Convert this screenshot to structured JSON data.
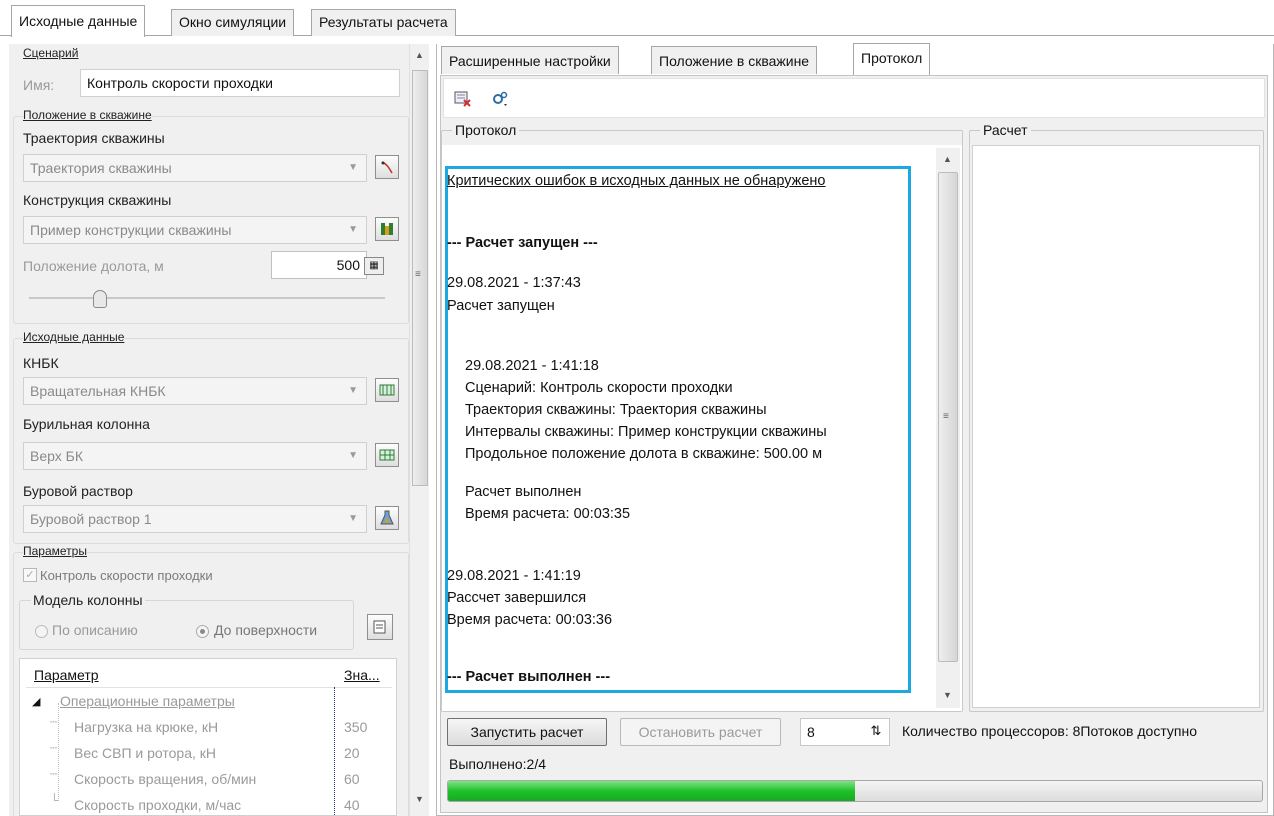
{
  "top_tabs": [
    "Исходные данные",
    "Окно симуляции",
    "Результаты расчета"
  ],
  "scenario": {
    "group": "Сценарий",
    "name_label": "Имя:",
    "name_value": "Контроль скорости проходки"
  },
  "position": {
    "group": "Положение в скважине",
    "trajectory_label": "Траектория скважины",
    "trajectory_value": "Траектория скважины",
    "construction_label": "Конструкция скважины",
    "construction_value": "Пример конструкции скважины",
    "bit_label": "Положение долота, м",
    "bit_value": "500"
  },
  "source": {
    "group": "Исходные данные",
    "knbk_label": "КНБК",
    "knbk_value": "Вращательная КНБК",
    "string_label": "Бурильная колонна",
    "string_value": "Верх БК",
    "mud_label": "Буровой раствор",
    "mud_value": "Буровой раствор 1"
  },
  "params": {
    "group": "Параметры",
    "rop_check": "Контроль скорости проходки",
    "model_title": "Модель колонны",
    "radio_desc": "По описанию",
    "radio_surface": "До поверхности",
    "col_param": "Параметр",
    "col_value": "Зна...",
    "category": "Операционные параметры",
    "rows": [
      {
        "name": "Нагрузка на крюке, кН",
        "value": "350"
      },
      {
        "name": "Вес СВП и ротора, кН",
        "value": "20"
      },
      {
        "name": "Скорость вращения, об/мин",
        "value": "60"
      },
      {
        "name": "Скорость проходки, м/час",
        "value": "40"
      }
    ]
  },
  "right_tabs": [
    "Расширенные настройки",
    "Положение в скважине",
    "Протокол"
  ],
  "protocol": {
    "title": "Протокол",
    "calc_title": "Расчет",
    "no_errors": "Критических ошибок в исходных данных не обнаружено",
    "started_header": "--- Расчет запущен ---",
    "ts1": "29.08.2021 - 1:37:43",
    "started": "Расчет запущен",
    "ts2": "29.08.2021 - 1:41:18",
    "scenario_line": "Сценарий: Контроль скорости проходки",
    "trajectory_line": "Траектория скважины: Траектория скважины",
    "intervals_line": "Интервалы скважины: Пример конструкции скважины",
    "bit_line": "Продольное положение долота в скважине: 500.00 м",
    "done": "Расчет выполнен",
    "time1": "Время расчета: 00:03:35",
    "ts3": "29.08.2021 - 1:41:19",
    "finished": "Рассчет завершился",
    "time2": "Время расчета: 00:03:36",
    "done_header": "--- Расчет выполнен ---"
  },
  "bottom": {
    "run_button": "Запустить расчет",
    "stop_button": "Остановить расчет",
    "cpu_value": "8",
    "cpu_label": "Количество процессоров:  8Потоков доступно",
    "progress_label": "Выполнено:2/4",
    "progress": 0.5
  },
  "colors": {
    "highlight": "#1ca8e1",
    "progress": "#1fc12b"
  }
}
